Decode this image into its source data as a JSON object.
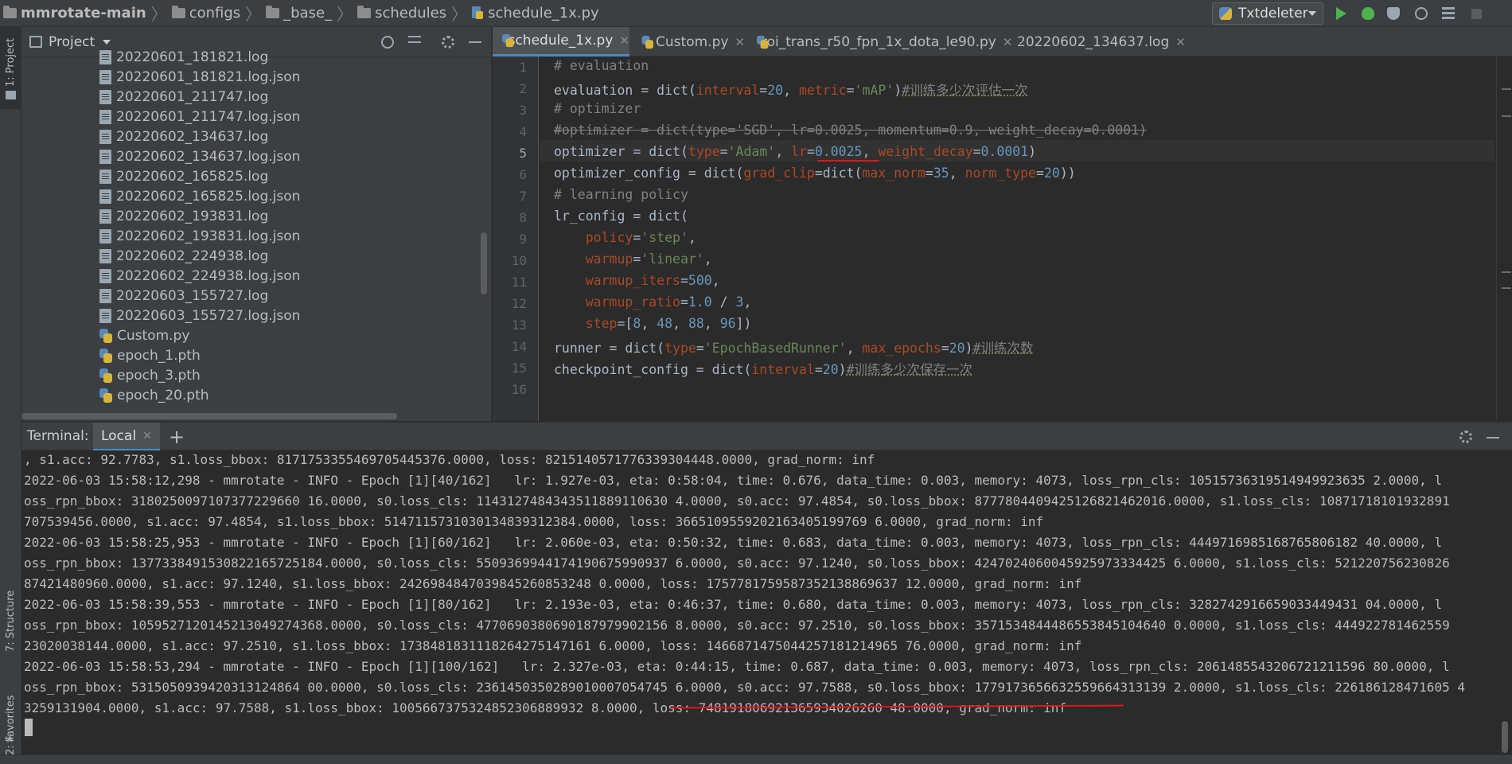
{
  "breadcrumb": [
    "mmrotate-main",
    "configs",
    "_base_",
    "schedules",
    "schedule_1x.py"
  ],
  "run_config": {
    "label": "Txtdeleter"
  },
  "left_stripe": {
    "project_tab": "1: Project",
    "structure_tab": "7: Structure",
    "favorites_tab": "2: Favorites"
  },
  "project_panel": {
    "title": "Project",
    "files": [
      {
        "name": "20220601_181821.log",
        "type": "log"
      },
      {
        "name": "20220601_181821.log.json",
        "type": "log"
      },
      {
        "name": "20220601_211747.log",
        "type": "log"
      },
      {
        "name": "20220601_211747.log.json",
        "type": "log"
      },
      {
        "name": "20220602_134637.log",
        "type": "log"
      },
      {
        "name": "20220602_134637.log.json",
        "type": "log"
      },
      {
        "name": "20220602_165825.log",
        "type": "log"
      },
      {
        "name": "20220602_165825.log.json",
        "type": "log"
      },
      {
        "name": "20220602_193831.log",
        "type": "log"
      },
      {
        "name": "20220602_193831.log.json",
        "type": "log"
      },
      {
        "name": "20220602_224938.log",
        "type": "log"
      },
      {
        "name": "20220602_224938.log.json",
        "type": "log"
      },
      {
        "name": "20220603_155727.log",
        "type": "log"
      },
      {
        "name": "20220603_155727.log.json",
        "type": "log"
      },
      {
        "name": "Custom.py",
        "type": "py"
      },
      {
        "name": "epoch_1.pth",
        "type": "py"
      },
      {
        "name": "epoch_3.pth",
        "type": "py"
      },
      {
        "name": "epoch_20.pth",
        "type": "py"
      }
    ]
  },
  "editor_tabs": [
    "schedule_1x.py",
    "Custom.py",
    "roi_trans_r50_fpn_1x_dota_le90.py",
    "20220602_134637.log"
  ],
  "editor": {
    "line_numbers": [
      "1",
      "2",
      "3",
      "4",
      "5",
      "6",
      "7",
      "8",
      "9",
      "10",
      "11",
      "12",
      "13",
      "14",
      "15",
      "16"
    ],
    "l1": "# evaluation",
    "l2": {
      "a": "evaluation = dict(",
      "k1": "interval",
      "b": "=",
      "n1": "20",
      "c": ", ",
      "k2": "metric",
      "d": "=",
      "s1": "'mAP'",
      "e": ")",
      "cn": "#训练多少次评估一次"
    },
    "l3": "# optimizer",
    "l4": "#optimizer = dict(type='SGD', lr=0.0025, momentum=0.9, weight_decay=0.0001)",
    "l5": {
      "a": "optimizer = dict(",
      "k1": "type",
      "b": "=",
      "s1": "'Adam'",
      "c": ", ",
      "k2": "lr",
      "d": "=",
      "n1": "0.0025",
      "e": ", ",
      "k3": "weight_decay",
      "f": "=",
      "n2": "0.0001",
      "g": ")"
    },
    "l6": {
      "a": "optimizer_config = dict(",
      "k1": "grad_clip",
      "b": "=dict(",
      "k2": "max_norm",
      "c": "=",
      "n1": "35",
      "d": ", ",
      "k3": "norm_type",
      "e": "=",
      "n2": "20",
      "f": "))"
    },
    "l7": "# learning policy",
    "l8": "lr_config = dict(",
    "l9": {
      "k": "policy",
      "b": "=",
      "s": "'step'",
      "c": ","
    },
    "l10": {
      "k": "warmup",
      "b": "=",
      "s": "'linear'",
      "c": ","
    },
    "l11": {
      "k": "warmup_iters",
      "b": "=",
      "n": "500",
      "c": ","
    },
    "l12": {
      "k": "warmup_ratio",
      "b": "=",
      "n1": "1.0",
      "c": " / ",
      "n2": "3",
      "d": ","
    },
    "l13": {
      "k": "step",
      "b": "=[",
      "n1": "8",
      "c1": ", ",
      "n2": "48",
      "c2": ", ",
      "n3": "88",
      "c3": ", ",
      "n4": "96",
      "d": "])"
    },
    "l14": {
      "a": "runner = dict(",
      "k1": "type",
      "b": "=",
      "s1": "'EpochBasedRunner'",
      "c": ", ",
      "k2": "max_epochs",
      "d": "=",
      "n1": "20",
      "e": ")",
      "cn": "#训练次数"
    },
    "l15": {
      "a": "checkpoint_config = dict(",
      "k1": "interval",
      "b": "=",
      "n1": "20",
      "e": ")",
      "cn": "#训练多少次保存一次"
    }
  },
  "terminal": {
    "label": "Terminal:",
    "tab": "Local",
    "lines": [
      ", s1.acc: 92.7783, s1.loss_bbox: 8171753355469705445376.0000, loss: 8215140571776339304448.0000, grad_norm: inf",
      "2022-06-03 15:58:12,298 - mmrotate - INFO - Epoch [1][40/162]   lr: 1.927e-03, eta: 0:58:04, time: 0.676, data_time: 0.003, memory: 4073, loss_rpn_cls: 10515736319514949923635 2.0000, l",
      "oss_rpn_bbox: 3180250097107377229660 16.0000, s0.loss_cls: 1143127484343511889110630 4.0000, s0.acc: 97.4854, s0.loss_bbox: 8777804409425126821462016.0000, s1.loss_cls: 10871718101932891",
      "707539456.0000, s1.acc: 97.4854, s1.loss_bbox: 5147115731030134839312384.0000, loss: 3665109559202163405199769 6.0000, grad_norm: inf",
      "2022-06-03 15:58:25,953 - mmrotate - INFO - Epoch [1][60/162]   lr: 2.060e-03, eta: 0:50:32, time: 0.683, data_time: 0.003, memory: 4073, loss_rpn_cls: 4449716985168765806182 40.0000, l",
      "oss_rpn_bbox: 1377338491530822165725184.0000, s0.loss_cls: 5509369944174190675990937 6.0000, s0.acc: 97.1240, s0.loss_bbox: 4247024060045925973334425 6.0000, s1.loss_cls: 521220756230826",
      "87421480960.0000, s1.acc: 97.1240, s1.loss_bbox: 2426984847039845260853248 0.0000, loss: 1757781759587352138869637 12.0000, grad_norm: inf",
      "2022-06-03 15:58:39,553 - mmrotate - INFO - Epoch [1][80/162]   lr: 2.193e-03, eta: 0:46:37, time: 0.680, data_time: 0.003, memory: 4073, loss_rpn_cls: 3282742916659033449431 04.0000, l",
      "oss_rpn_bbox: 1059527120145213049274368.0000, s0.loss_cls: 4770690380690187979902156 8.0000, s0.acc: 97.2510, s0.loss_bbox: 3571534844486553845104640 0.0000, s1.loss_cls: 444922781462559",
      "23020038144.0000, s1.acc: 97.2510, s1.loss_bbox: 1738481831118264275147161 6.0000, loss: 1466871475044257181214965 76.0000, grad_norm: inf",
      "2022-06-03 15:58:53,294 - mmrotate - INFO - Epoch [1][100/162]   lr: 2.327e-03, eta: 0:44:15, time: 0.687, data_time: 0.003, memory: 4073, loss_rpn_cls: 2061485543206721211596 80.0000, l",
      "oss_rpn_bbox: 5315050939420313124864 00.0000, s0.loss_cls: 2361450350289010007054745 6.0000, s0.acc: 97.7588, s0.loss_bbox: 1779173656632559664313139 2.0000, s1.loss_cls: 226186128471605 4",
      "3259131904.0000, s1.acc: 97.7588, s1.loss_bbox: 1005667375324852306889932 8.0000, loss: 748191806921365934026260 48.0000, grad_norm: inf"
    ]
  },
  "colors": {
    "annotation_red": "#e0161b",
    "accent": "#4a88c7"
  }
}
